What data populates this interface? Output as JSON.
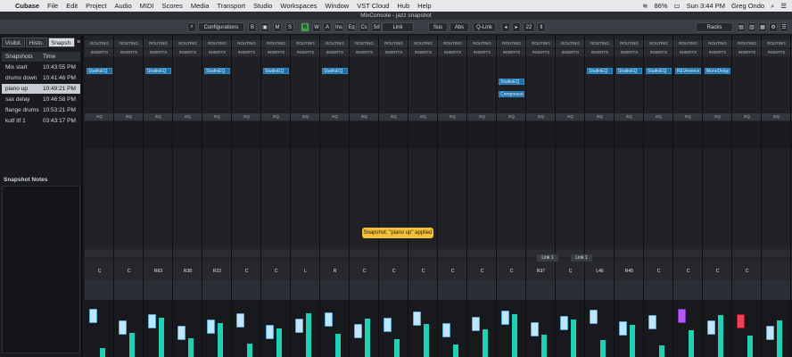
{
  "menu": {
    "app": "Cubase",
    "items": [
      "File",
      "Edit",
      "Project",
      "Audio",
      "MIDI",
      "Scores",
      "Media",
      "Transport",
      "Studio",
      "Workspaces",
      "Window",
      "VST Cloud",
      "Hub",
      "Help"
    ],
    "battery": "86%",
    "clock": "Sun 3:44 PM",
    "user": "Greg Ondo"
  },
  "window": {
    "title": "MixConsole - jazz snapshot"
  },
  "toolbar": {
    "configurations": "Configurations",
    "b_btn": "B",
    "m": "M",
    "s": "S",
    "r": "R",
    "w": "W",
    "a": "A",
    "ins": "Ins",
    "eq": "Eq",
    "cs": "Cs",
    "sd": "Sd",
    "link": "Link",
    "sus": "Sus",
    "abs": "Abs",
    "qlink": "Q-Link",
    "count": "22",
    "racks": "Racks"
  },
  "left": {
    "tabs": [
      "Visibil.",
      "Histo.",
      "Snapsh."
    ],
    "col_name": "Snapshots",
    "col_time": "Time",
    "snapshots": [
      {
        "name": "Mix start",
        "time": "10:43:55 PM"
      },
      {
        "name": "drums down",
        "time": "10:41:46 PM"
      },
      {
        "name": "piano up",
        "time": "10:49:21 PM"
      },
      {
        "name": "sax delay",
        "time": "10:46:58 PM"
      },
      {
        "name": "flange drums",
        "time": "10:53:21 PM"
      },
      {
        "name": "kutf itf 1",
        "time": "03:43:17 PM"
      }
    ],
    "notes_label": "Snapshot Notes"
  },
  "mixer": {
    "routing_label": "ROUTING",
    "inserts_label": "INSERTS",
    "plugins": [
      {
        "strip": 0,
        "name": "StudioEQ"
      },
      {
        "strip": 2,
        "name": "StudioEQ"
      },
      {
        "strip": 4,
        "name": "StudioEQ"
      },
      {
        "strip": 6,
        "name": "StudioEQ"
      },
      {
        "strip": 8,
        "name": "StudioEQ"
      },
      {
        "strip": 18,
        "name": "StudioEQ"
      },
      {
        "strip": 19,
        "name": "StudioEQ"
      },
      {
        "strip": 14,
        "name": "StudioEQ"
      },
      {
        "strip": 14,
        "name": "Compressor"
      },
      {
        "strip": 17,
        "name": "StudioEQ"
      },
      {
        "strip": 20,
        "name": "REVerence"
      },
      {
        "strip": 21,
        "name": "MonoDelay"
      }
    ],
    "eq_header": [
      "EQ",
      "EQ",
      "EQ",
      "EQ",
      "EQ",
      "EQ",
      "EQ",
      "EQ",
      "EQ",
      "EQ",
      "EQ",
      "EQ",
      "EQ",
      "EQ",
      "EQ",
      "EQ",
      "EQ",
      "EQ",
      "EQ",
      "EQ",
      "EQ",
      "EQ",
      "EQ",
      "EQ"
    ],
    "tooltip": "Snapshot: \"piano up\" applied",
    "pan": [
      "C",
      "C",
      "R63",
      "R38",
      "R22",
      "C",
      "C",
      "L",
      "R",
      "C",
      "C",
      "C",
      "C",
      "C",
      "C",
      "R37",
      "C",
      "L46",
      "R45",
      "C",
      "C",
      "C",
      "C"
    ],
    "link1": "Link 1",
    "link2": "Link 1"
  },
  "colors": {
    "accent": "#3fa34d",
    "orange": "#e6892b",
    "blue": "#1c6fa8",
    "meter": "#1fd1b3",
    "purple": "#9a3fe0",
    "red": "#e0233a"
  }
}
